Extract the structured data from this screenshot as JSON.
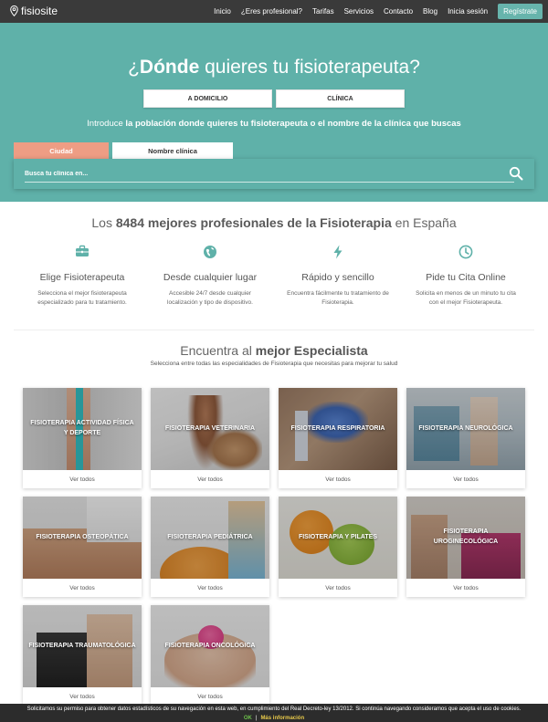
{
  "nav": {
    "logo": "fisiosite",
    "links": [
      "Inicio",
      "¿Eres profesional?",
      "Tarifas",
      "Servicios",
      "Contacto",
      "Blog",
      "Inicia sesión"
    ],
    "cta": "Regístrate"
  },
  "hero": {
    "title_pre": "¿",
    "title_bold": "Dónde",
    "title_post": " quieres tu fisioterapeuta?",
    "btn_home": "A DOMICILIO",
    "btn_clinic": "CLÍNICA",
    "intro_pre": "Introduce ",
    "intro_bold": "la población donde quieres tu fisioterapeuta o el nombre de la clínica que buscas",
    "tab_city": "Ciudad",
    "tab_clinic": "Nombre clínica",
    "search_placeholder": "Busca tu clínica en..."
  },
  "stats": {
    "title_pre": "Los ",
    "title_bold": "8484 mejores profesionales de la Fisioterapia",
    "title_post": " en España",
    "features": [
      {
        "icon": "briefcase-icon",
        "title": "Elige Fisioterapeuta",
        "desc": "Selecciona el mejor fisioterapeuta especializado para tu tratamiento."
      },
      {
        "icon": "globe-icon",
        "title": "Desde cualquier lugar",
        "desc": "Accesible 24/7 desde cualquier localización y tipo de dispositivo."
      },
      {
        "icon": "lightning-icon",
        "title": "Rápido y sencillo",
        "desc": "Encuentra fácilmente tu tratamiento de Fisioterapia."
      },
      {
        "icon": "clock-icon",
        "title": "Pide tu Cita Online",
        "desc": "Solicita en menos de un minuto tu cita con el mejor Fisioterapeuta."
      }
    ]
  },
  "specialists": {
    "title_pre": "Encuentra al ",
    "title_bold": "mejor Especialista",
    "subtitle": "Selecciona entre todas las especialidades de Fisioterapia que necesitas para mejorar tu salud",
    "cards": [
      {
        "label": "FISIOTERAPIA ACTIVIDAD FÍSICA Y DEPORTE",
        "link": "Ver todos"
      },
      {
        "label": "FISIOTERAPIA VETERINARIA",
        "link": "Ver todos"
      },
      {
        "label": "FISIOTERAPIA RESPIRATORIA",
        "link": "Ver todos"
      },
      {
        "label": "FISIOTERAPIA NEUROLÓGICA",
        "link": "Ver todos"
      },
      {
        "label": "FISIOTERAPIA OSTEOPÁTICA",
        "link": "Ver todos"
      },
      {
        "label": "FISIOTERAPIA PEDIÁTRICA",
        "link": "Ver todos"
      },
      {
        "label": "FISIOTERAPIA Y PILATES",
        "link": "Ver todos"
      },
      {
        "label": "FISIOTERAPIA UROGINECOLÓGICA",
        "link": "Ver todos"
      },
      {
        "label": "FISIOTERAPIA TRAUMATOLÓGICA",
        "link": "Ver todos"
      },
      {
        "label": "FISIOTERAPIA ONCOLÓGICA",
        "link": "Ver todos"
      }
    ]
  },
  "cookie": {
    "text": "Solicitamos su permiso para obtener datos estadísticos de su navegación en esta web, en cumplimiento del Real Decreto-ley 13/2012. Si continúa navegando consideramos que acepta el uso de cookies.",
    "ok": "OK",
    "separator": "|",
    "more": "Más información"
  },
  "colors": {
    "teal": "#5fb1a9",
    "nav_bg": "#3a3a3a",
    "coral": "#ee9d84"
  }
}
